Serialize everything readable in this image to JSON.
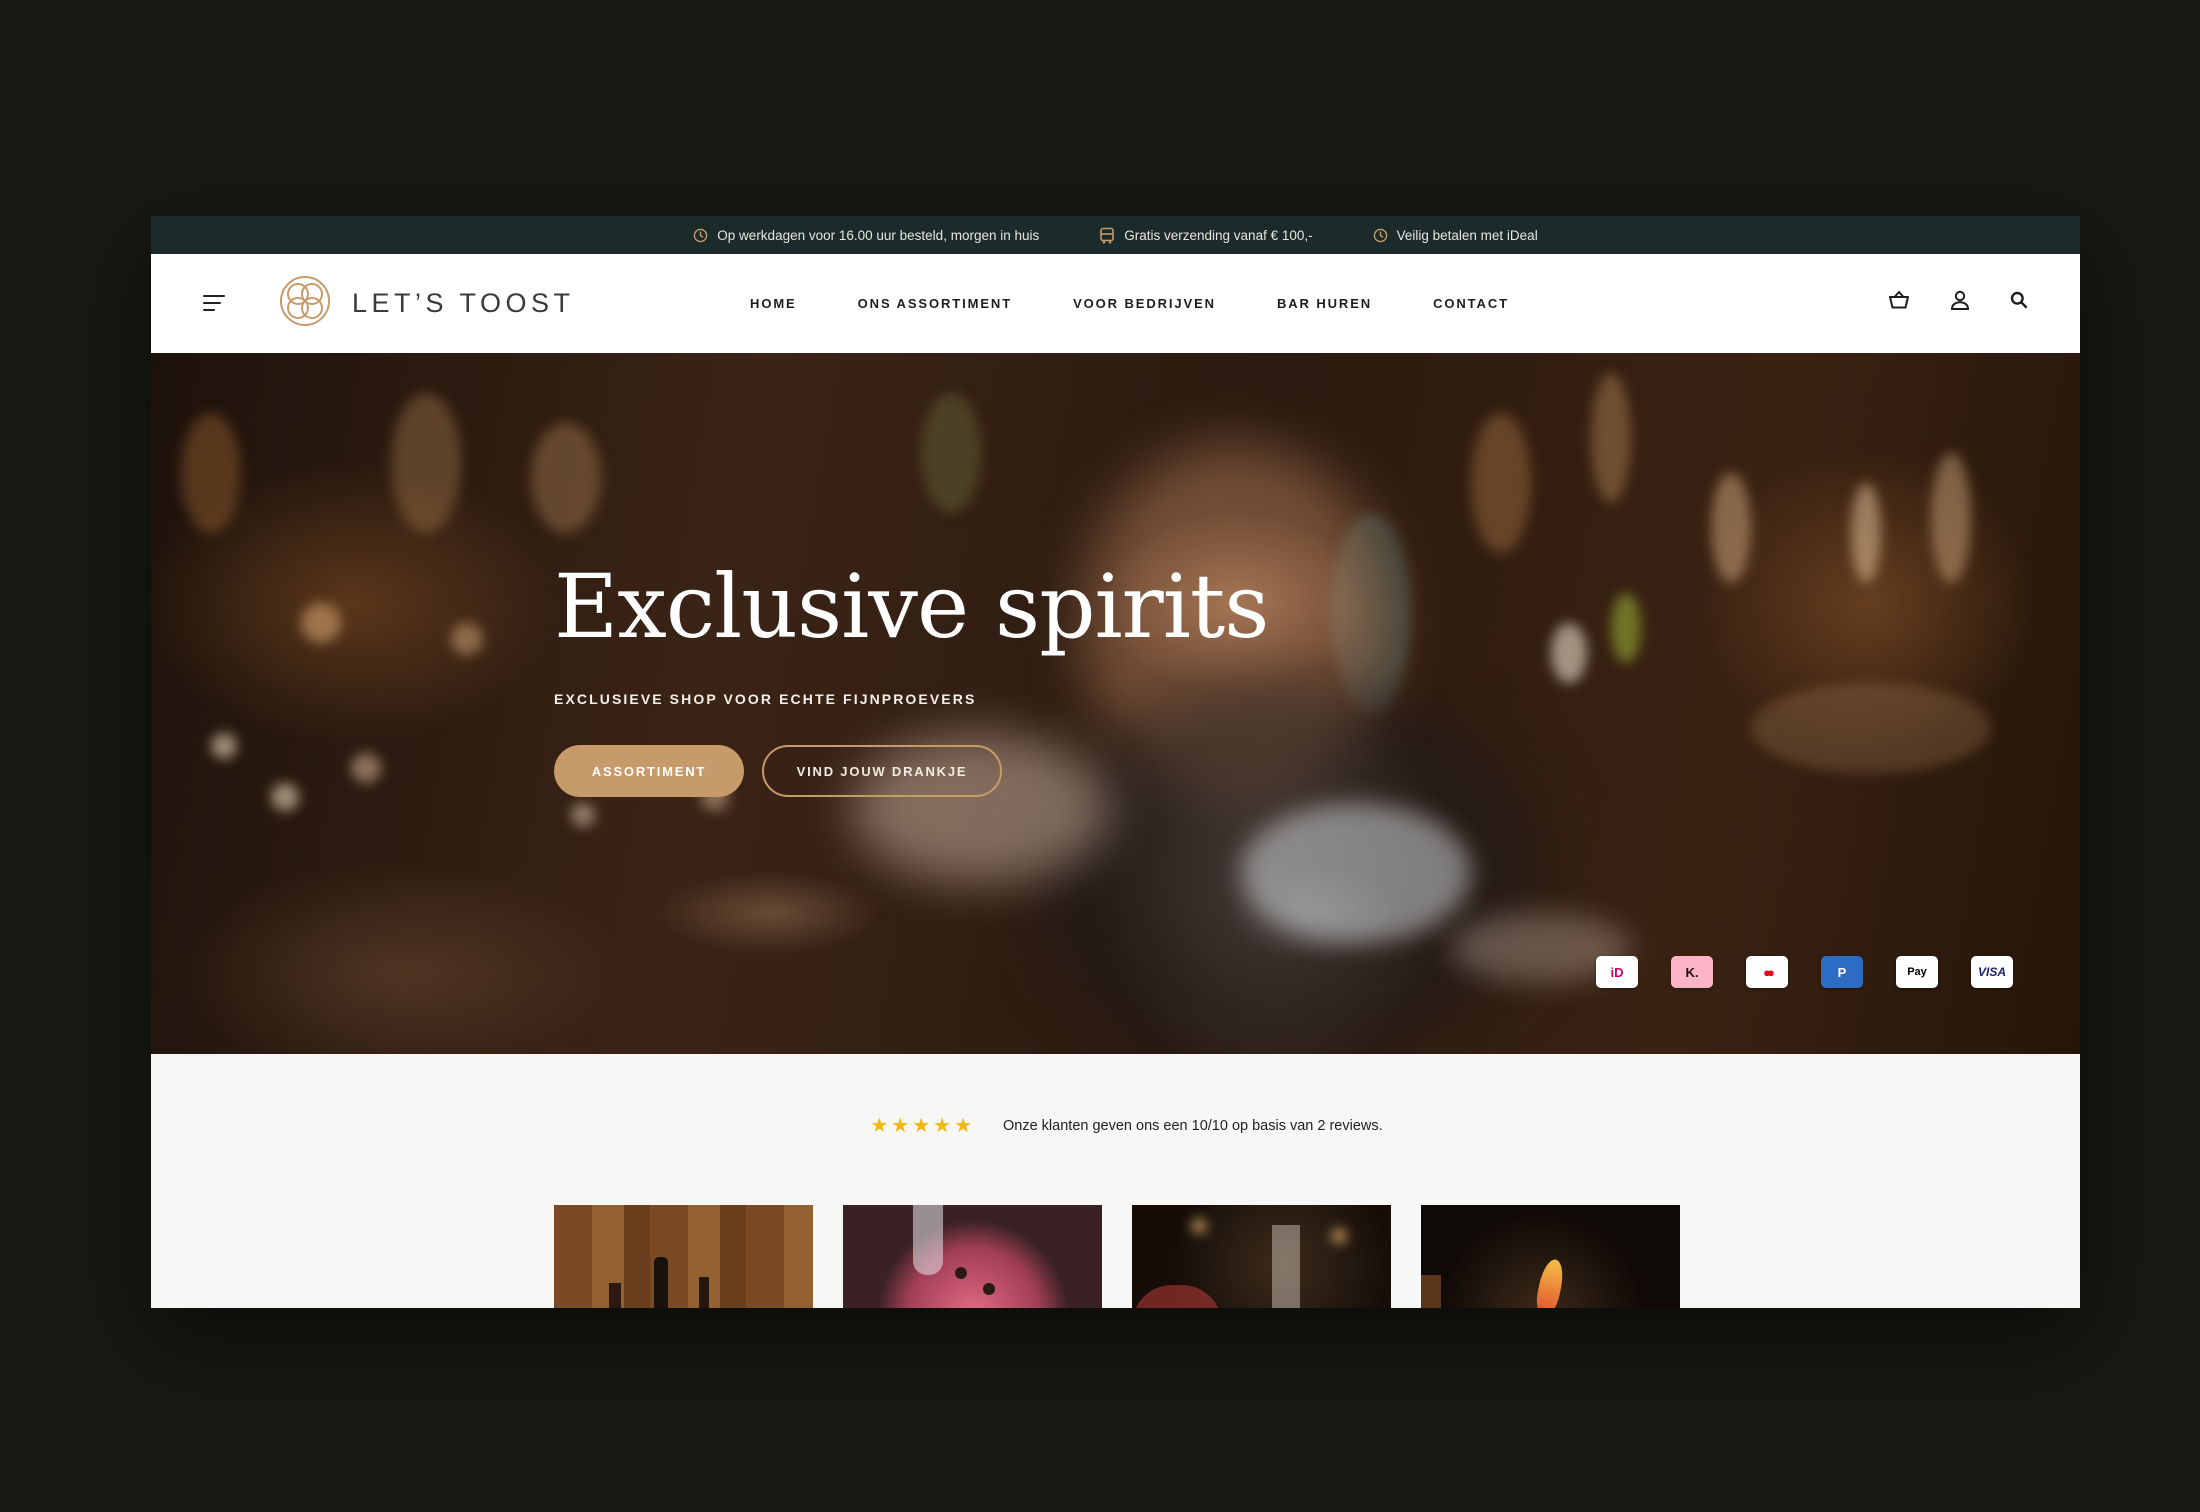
{
  "topbar": {
    "usps": [
      {
        "icon": "clock-icon",
        "text": "Op werkdagen voor 16.00 uur besteld, morgen in huis"
      },
      {
        "icon": "delivery-van-icon",
        "text": "Gratis verzending vanaf € 100,-"
      },
      {
        "icon": "clock-icon",
        "text": "Veilig betalen met iDeal"
      }
    ]
  },
  "header": {
    "brand": "LET’S TOOST",
    "nav": [
      "HOME",
      "ONS ASSORTIMENT",
      "VOOR BEDRIJVEN",
      "BAR HUREN",
      "CONTACT"
    ],
    "icons": [
      "cart-icon",
      "user-icon",
      "search-icon"
    ]
  },
  "hero": {
    "title": "Exclusive spirits",
    "subtitle": "EXCLUSIEVE SHOP VOOR ECHTE FIJNPROEVERS",
    "primary_button": "ASSORTIMENT",
    "secondary_button": "VIND JOUW DRANKJE",
    "payment_methods": [
      {
        "name": "iDEAL",
        "label": "iD",
        "bg": "#ffffff",
        "fg": "#cc0066"
      },
      {
        "name": "Klarna",
        "label": "K.",
        "bg": "#ffb3c7",
        "fg": "#17120f"
      },
      {
        "name": "Mastercard",
        "label": "●●",
        "bg": "#ffffff",
        "fg": "#eb001b"
      },
      {
        "name": "PayPal",
        "label": "P",
        "bg": "#2c6cc4",
        "fg": "#ffffff"
      },
      {
        "name": "Apple Pay",
        "label": "Pay",
        "bg": "#ffffff",
        "fg": "#000000"
      },
      {
        "name": "Visa",
        "label": "VISA",
        "bg": "#ffffff",
        "fg": "#1a1f71"
      }
    ]
  },
  "reviews": {
    "rating_stars": 5,
    "text": "Onze klanten geven ons een 10/10 op basis van 2 reviews."
  },
  "colors": {
    "topbar_bg": "#1b2a2b",
    "accent": "#c79a6a",
    "star": "#f2b713"
  }
}
